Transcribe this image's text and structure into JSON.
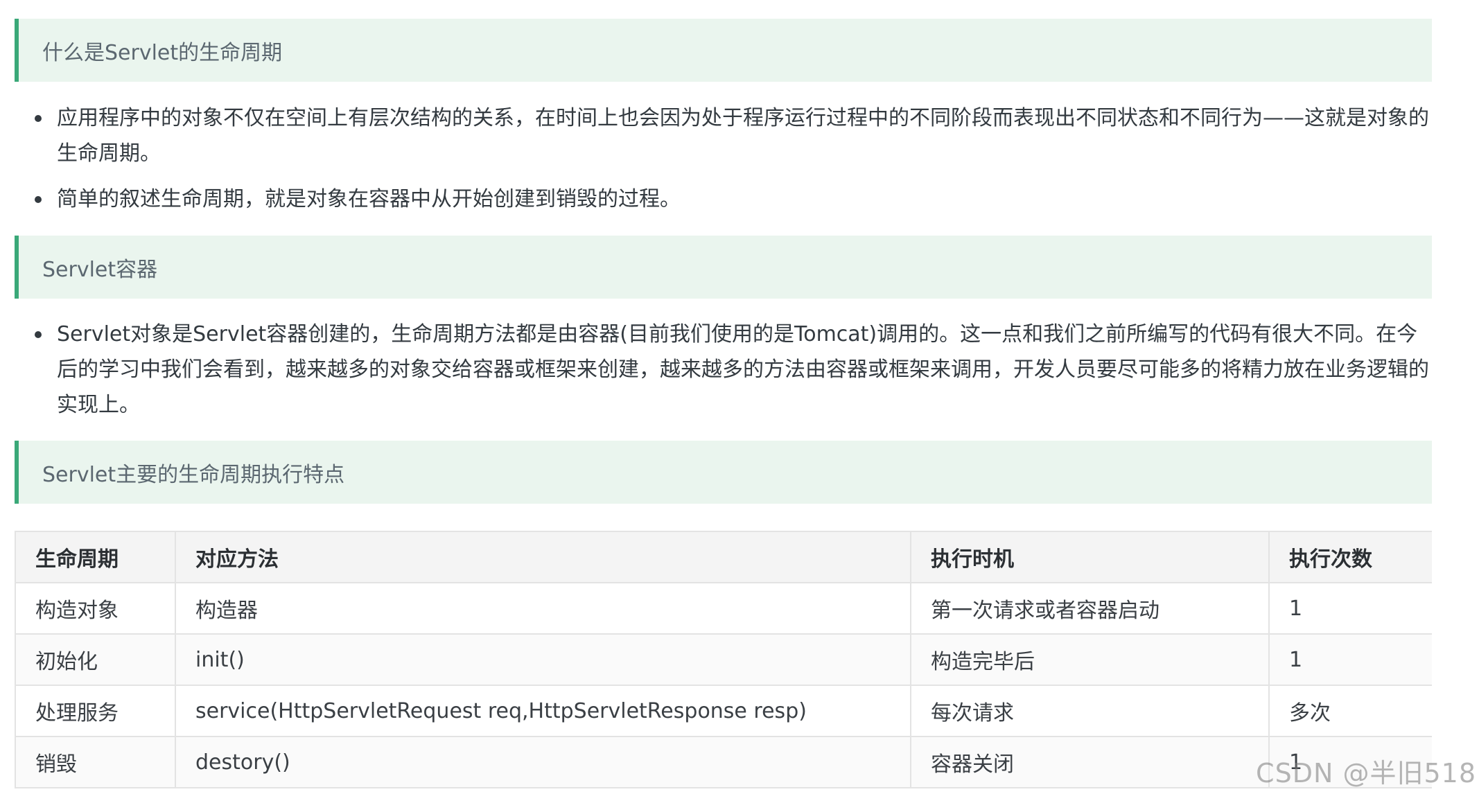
{
  "sections": [
    {
      "heading": "什么是Servlet的生命周期",
      "bullets": [
        "应用程序中的对象不仅在空间上有层次结构的关系，在时间上也会因为处于程序运行过程中的不同阶段而表现出不同状态和不同行为——这就是对象的生命周期。",
        "简单的叙述生命周期，就是对象在容器中从开始创建到销毁的过程。"
      ]
    },
    {
      "heading": "Servlet容器",
      "bullets": [
        "Servlet对象是Servlet容器创建的，生命周期方法都是由容器(目前我们使用的是Tomcat)调用的。这一点和我们之前所编写的代码有很大不同。在今后的学习中我们会看到，越来越多的对象交给容器或框架来创建，越来越多的方法由容器或框架来调用，开发人员要尽可能多的将精力放在业务逻辑的实现上。"
      ]
    },
    {
      "heading": "Servlet主要的生命周期执行特点"
    }
  ],
  "table": {
    "headers": [
      "生命周期",
      "对应方法",
      "执行时机",
      "执行次数"
    ],
    "rows": [
      [
        "构造对象",
        "构造器",
        "第一次请求或者容器启动",
        "1"
      ],
      [
        "初始化",
        "init()",
        "构造完毕后",
        "1"
      ],
      [
        "处理服务",
        "service(HttpServletRequest req,HttpServletResponse resp)",
        "每次请求",
        "多次"
      ],
      [
        "销毁",
        "destory()",
        "容器关闭",
        "1"
      ]
    ]
  },
  "watermark": "CSDN @半旧518"
}
